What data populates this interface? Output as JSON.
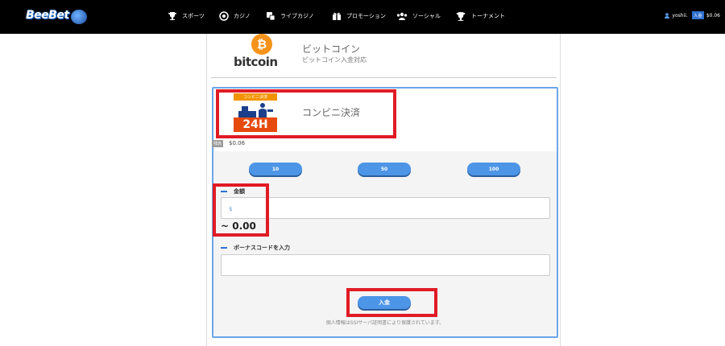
{
  "header": {
    "logo_text": "BeeBet",
    "nav": [
      {
        "label": "スポーツ",
        "icon": "trophy-icon"
      },
      {
        "label": "カジノ",
        "icon": "poker-chip-icon"
      },
      {
        "label": "ライブカジノ",
        "icon": "dice-icon"
      },
      {
        "label": "プロモーション",
        "icon": "gift-icon"
      },
      {
        "label": "ソーシャル",
        "icon": "users-icon"
      },
      {
        "label": "トーナメント",
        "icon": "trophy-icon"
      }
    ],
    "user": {
      "name": "yoshii.",
      "deposit_label": "入金",
      "balance": "$0.06"
    }
  },
  "colors": {
    "accent": "#4d95e6",
    "highlight": "#e01b24",
    "bitcoin": "#f7931a"
  },
  "bitcoin": {
    "symbol": "₿",
    "word": "bitcoin",
    "title": "ビットコイン",
    "subtitle": "ビットコイン入金対応"
  },
  "method": {
    "badge_top": "コンビニ決済",
    "badge_bottom": "24H",
    "title": "コンビニ決済"
  },
  "fee": {
    "tag": "残高",
    "value": "$0.06"
  },
  "amount_buttons": [
    "10",
    "50",
    "100"
  ],
  "amount": {
    "label": "金額",
    "prefix": "$",
    "approx": "~ 0.00"
  },
  "bonus": {
    "label": "ボーナスコードを入力",
    "value": ""
  },
  "submit_label": "入金",
  "privacy_note": "個人情報はSSIサーバ証明書により保護されています。"
}
